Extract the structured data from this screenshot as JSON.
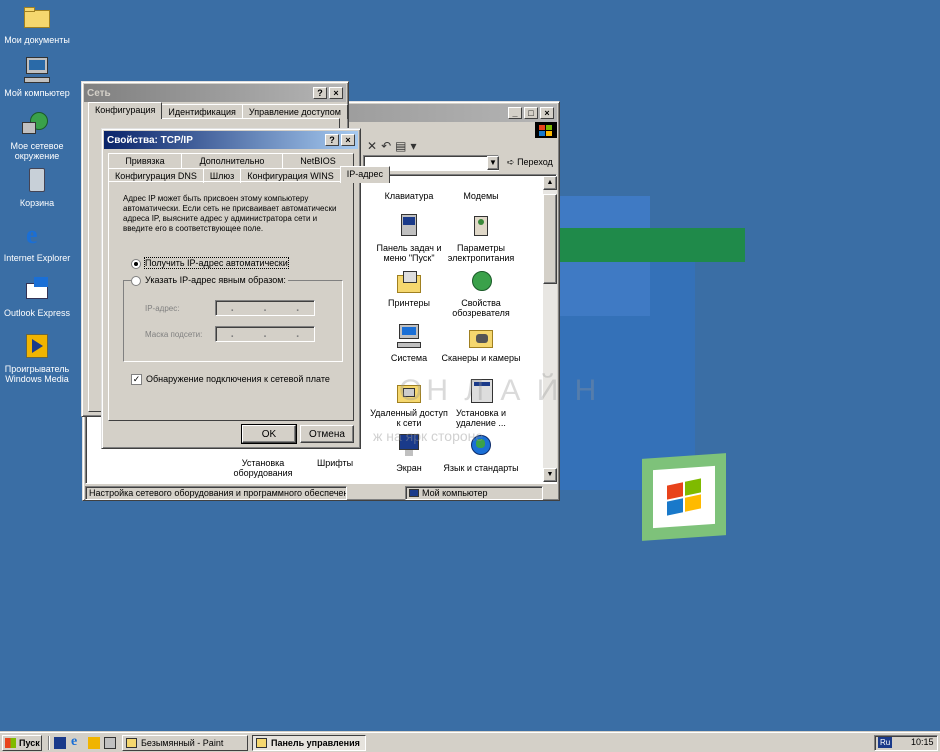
{
  "desktop": {
    "icons": [
      {
        "label": "Мои документы",
        "icon": "folder-icon"
      },
      {
        "label": "Мой компьютер",
        "icon": "computer-icon"
      },
      {
        "label": "Мое сетевое окружение",
        "icon": "network-icon"
      },
      {
        "label": "Корзина",
        "icon": "recycle-bin-icon"
      },
      {
        "label": "Internet Explorer",
        "icon": "ie-icon"
      },
      {
        "label": "Outlook Express",
        "icon": "outlook-icon"
      },
      {
        "label": "Проигрыватель Windows Media",
        "icon": "media-player-icon"
      }
    ],
    "watermark_line1": "ОН Л А Й Н",
    "watermark_line2": "ж   на ярк   стороне"
  },
  "control_panel": {
    "address_go": "Переход",
    "items": [
      {
        "label": "Клавиатура"
      },
      {
        "label": "Модемы"
      },
      {
        "label": "Панель задач и меню \"Пуск\""
      },
      {
        "label": "Параметры электропитания"
      },
      {
        "label": "Принтеры"
      },
      {
        "label": "Свойства обозревателя"
      },
      {
        "label": "Система"
      },
      {
        "label": "Сканеры и камеры"
      },
      {
        "label": "Удаленный доступ к сети"
      },
      {
        "label": "Установка и удаление ..."
      },
      {
        "label": "Экран"
      },
      {
        "label": "Язык и стандарты"
      },
      {
        "label": "Установка оборудования"
      },
      {
        "label": "Шрифты"
      }
    ],
    "status_left": "Настройка сетевого оборудования и программного обеспечения.",
    "status_right": "Мой компьютер"
  },
  "network_dialog": {
    "title": "Сеть",
    "tabs": [
      "Конфигурация",
      "Идентификация",
      "Управление доступом"
    ]
  },
  "tcpip_dialog": {
    "title": "Свойства: TCP/IP",
    "tabs_row1": [
      "Привязка",
      "Дополнительно",
      "NetBIOS"
    ],
    "tabs_row2": [
      "Конфигурация DNS",
      "Шлюз",
      "Конфигурация WINS",
      "IP-адрес"
    ],
    "description": "Адрес IP может быть присвоен этому компьютеру автоматически. Если сеть не присваивает автоматически адреса IP, выясните адрес у администратора сети и введите его в соответствующее поле.",
    "radio_auto": "Получить IP-адрес автоматически",
    "radio_manual": "Указать IP-адрес явным образом:",
    "ip_label": "IP-адрес:",
    "mask_label": "Маска подсети:",
    "checkbox_label": "Обнаружение подключения к сетевой плате",
    "ok": "OK",
    "cancel": "Отмена",
    "help_btn": "?",
    "close_btn": "×"
  },
  "taskbar": {
    "start": "Пуск",
    "tasks": [
      "Безымянный - Paint",
      "Панель управления"
    ],
    "lang": "Ru",
    "clock": "10:15"
  }
}
